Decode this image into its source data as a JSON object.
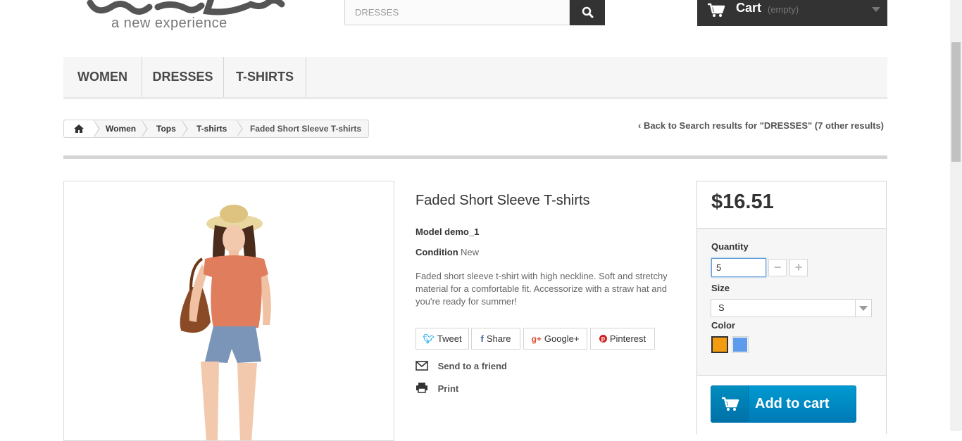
{
  "header": {
    "logo_tagline": "a new experience",
    "search": {
      "value": "DRESSES",
      "button_icon": "search-icon"
    },
    "cart": {
      "label": "Cart",
      "status": "(empty)"
    }
  },
  "nav": {
    "items": [
      "WOMEN",
      "DRESSES",
      "T-SHIRTS"
    ]
  },
  "breadcrumb": {
    "items": [
      "Women",
      "Tops",
      "T-shirts",
      "Faded Short Sleeve T-shirts"
    ],
    "back_link": "Back to Search results for \"DRESSES\" (7 other results)"
  },
  "product": {
    "title": "Faded Short Sleeve T-shirts",
    "model": "Model demo_1",
    "condition_label": "Condition",
    "condition_value": "New",
    "description": "Faded short sleeve t-shirt with high neckline. Soft and stretchy material for a comfortable fit. Accessorize with a straw hat and you're ready for summer!",
    "social": [
      "Tweet",
      "Share",
      "Google+",
      "Pinterest"
    ],
    "send_to_friend": "Send to a friend",
    "print": "Print"
  },
  "buy_box": {
    "price": "$16.51",
    "quantity_label": "Quantity",
    "quantity_value": "5",
    "size_label": "Size",
    "size_value": "S",
    "color_label": "Color",
    "colors": [
      "#f39c11",
      "#5d9cec"
    ],
    "add_to_cart": "Add to cart"
  }
}
